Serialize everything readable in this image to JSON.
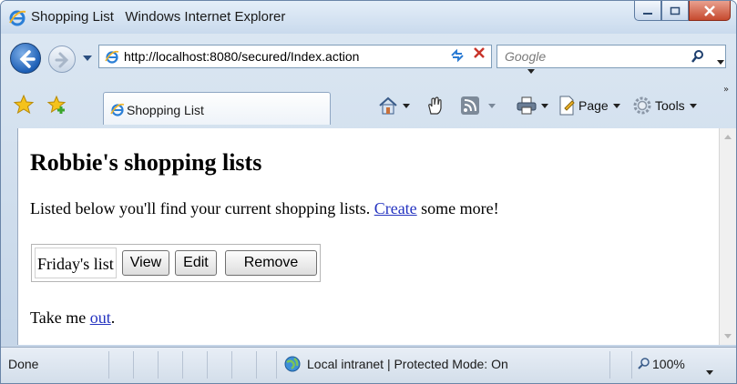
{
  "window": {
    "title": "Shopping List   Windows Internet Explorer"
  },
  "address": {
    "url": "http://localhost:8080/secured/Index.action"
  },
  "search": {
    "placeholder": "Google"
  },
  "tab": {
    "label": "Shopping List"
  },
  "commandbar": {
    "page_label": "Page",
    "tools_label": "Tools"
  },
  "page": {
    "title": "Robbie's shopping lists",
    "intro_before": "Listed below you'll find your current shopping lists. ",
    "create_link": "Create",
    "intro_after": " some more!",
    "lists": [
      {
        "name": "Friday's list",
        "view_label": "View",
        "edit_label": "Edit",
        "remove_label": "Remove"
      }
    ],
    "takeme_before": "Take me ",
    "out_link": "out",
    "takeme_after": "."
  },
  "status": {
    "text": "Done",
    "zone": "Local intranet | Protected Mode: On",
    "zoom": "100%"
  },
  "colors": {
    "link": "#2433c0",
    "close_button": "#c64a2e",
    "chrome": "#c9daed"
  }
}
